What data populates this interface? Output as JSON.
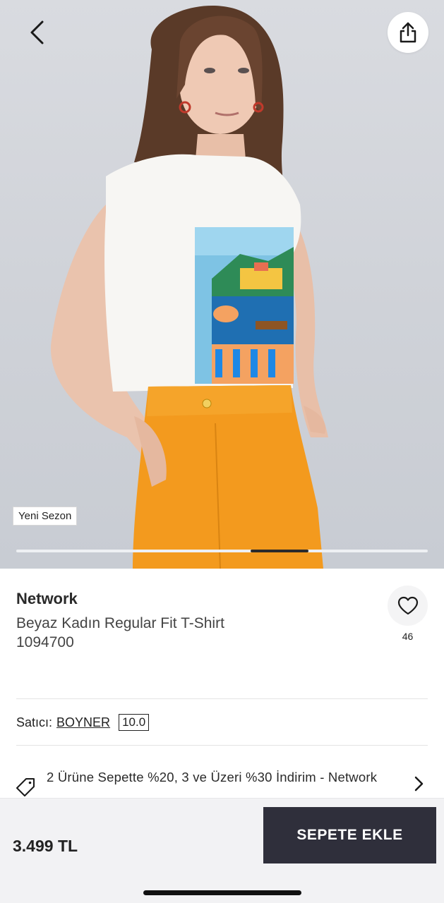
{
  "header": {
    "back_icon": "chevron-left-icon",
    "share_icon": "share-icon"
  },
  "gallery": {
    "badge": "Yeni Sezon",
    "slide_progress": {
      "current_start": 0.57,
      "current_end": 0.71
    }
  },
  "product": {
    "brand": "Network",
    "title": "Beyaz Kadın Regular Fit T-Shirt 1094700",
    "favorite_count": "46",
    "favorite_icon": "heart-icon"
  },
  "seller": {
    "label": "Satıcı:",
    "name": "BOYNER",
    "score": "10.0"
  },
  "promo": {
    "icon": "price-tag-icon",
    "text": "2 Ürüne Sepette %20, 3 ve Üzeri %30 İndirim - Network",
    "chevron": "chevron-right-icon"
  },
  "bottom_bar": {
    "price": "3.499 TL",
    "add_to_cart": "SEPETE EKLE"
  },
  "colors": {
    "button_dark": "#2f2f3b",
    "background_gray": "#f2f2f4"
  }
}
